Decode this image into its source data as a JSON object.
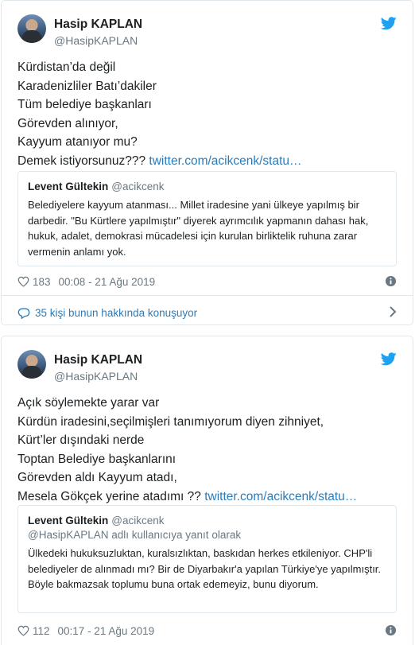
{
  "tweets": [
    {
      "author_name": "Hasip KAPLAN",
      "author_handle": "@HasipKAPLAN",
      "lines": [
        "Kürdistan’da değil",
        "Karadenizliler Batı’dakiler",
        "Tüm belediye başkanları",
        "Görevden alınıyor,",
        "Kayyum atanıyor mu?",
        "Demek istiyorsunuz??? "
      ],
      "link": "twitter.com/acikcenk/statu…",
      "quote": {
        "name": "Levent Gültekin",
        "handle": "@acikcenk",
        "reply_to": "",
        "text": "Belediyelere kayyum atanması... Millet iradesine yani ülkeye yapılmış bir darbedir. \"Bu Kürtlere yapılmıştır\" diyerek ayrımcılık yapmanın dahası hak, hukuk, adalet, demokrasi mücadelesi için kurulan birliktelik ruhuna zarar vermenin anlamı yok."
      },
      "likes": "183",
      "timestamp": "00:08 - 21 Ağu 2019",
      "conversation": "35 kişi bunun hakkında konuşuyor"
    },
    {
      "author_name": "Hasip KAPLAN",
      "author_handle": "@HasipKAPLAN",
      "lines": [
        "Açık söylemekte yarar var",
        "Kürdün iradesini,seçilmişleri tanımıyorum diyen zihniyet,",
        "Kürt’ler dışındaki nerde",
        "Toptan Belediye başkanlarını",
        "Görevden aldı Kayyum atadı,",
        "Mesela Gökçek yerine atadımı ?? "
      ],
      "link": "twitter.com/acikcenk/statu…",
      "quote": {
        "name": "Levent Gültekin",
        "handle": "@acikcenk",
        "reply_to": "@HasipKAPLAN adlı kullanıcıya yanıt olarak",
        "text": "Ülkedeki hukuksuzluktan, kuralsızlıktan, baskıdan herkes etkileniyor. CHP'li belediyeler de alınmadı mı? Bir de Diyarbakır'a yapılan Türkiye'ye yapılmıştır. Böyle bakmazsak toplumu buna ortak edemeyiz, bunu diyorum."
      },
      "likes": "112",
      "timestamp": "00:17 - 21 Ağu 2019"
    }
  ],
  "colors": {
    "link": "#2b7bb9",
    "border": "#e1e8ed",
    "muted": "#697882",
    "twitter_blue": "#1da1f2"
  },
  "icons": {
    "brand": "twitter-bird-icon",
    "like": "heart-icon",
    "info": "info-icon",
    "conversation": "speech-bubble-icon",
    "chevron": "chevron-right-icon"
  }
}
